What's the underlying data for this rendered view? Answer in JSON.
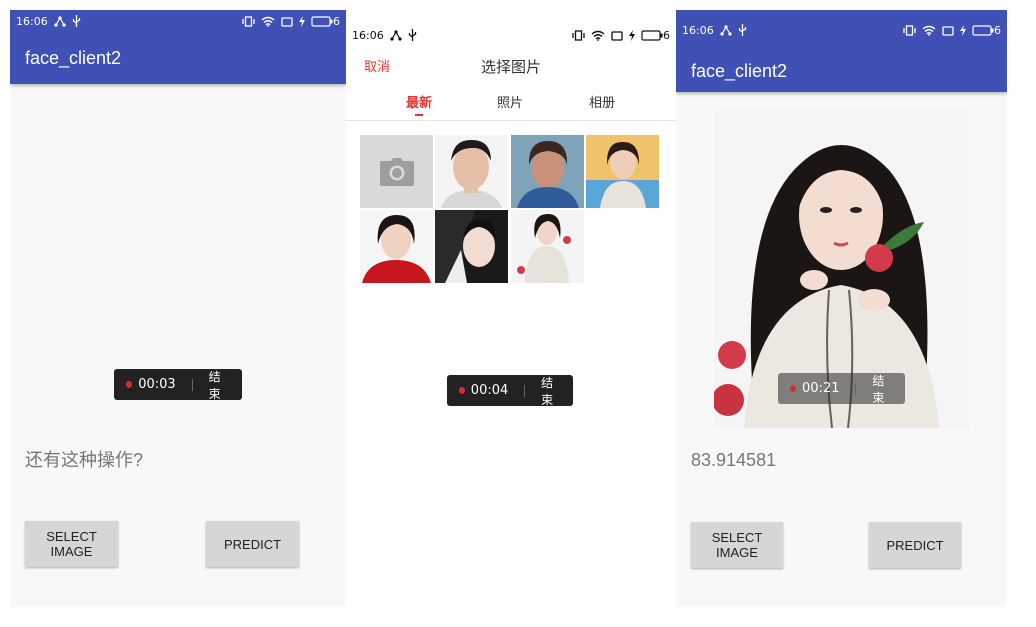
{
  "colors": {
    "appbar": "#3f51b5",
    "accent_red": "#e53935",
    "recorder_bg": "#222222"
  },
  "status": {
    "p1_time": "16:06",
    "p1_battery": "6",
    "p2_time": "16:06",
    "p2_battery": "6",
    "p3_time": "16:06",
    "p3_battery": "6"
  },
  "app_title": "face_client2",
  "screen1": {
    "recorder": {
      "time": "00:03",
      "end_label": "结束"
    },
    "result_text": "还有这种操作?",
    "select_button": "SELECT\nIMAGE",
    "predict_button": "PREDICT"
  },
  "screen2": {
    "cancel_label": "取消",
    "title": "选择图片",
    "tabs": [
      {
        "label": "最新",
        "active": true
      },
      {
        "label": "照片",
        "active": false
      },
      {
        "label": "相册",
        "active": false
      }
    ],
    "camera_icon": "camera-icon",
    "recorder": {
      "time": "00:04",
      "end_label": "结束"
    }
  },
  "screen3": {
    "recorder": {
      "time": "00:21",
      "end_label": "结束"
    },
    "score_text": "83.914581",
    "select_button": "SELECT\nIMAGE",
    "predict_button": "PREDICT"
  }
}
